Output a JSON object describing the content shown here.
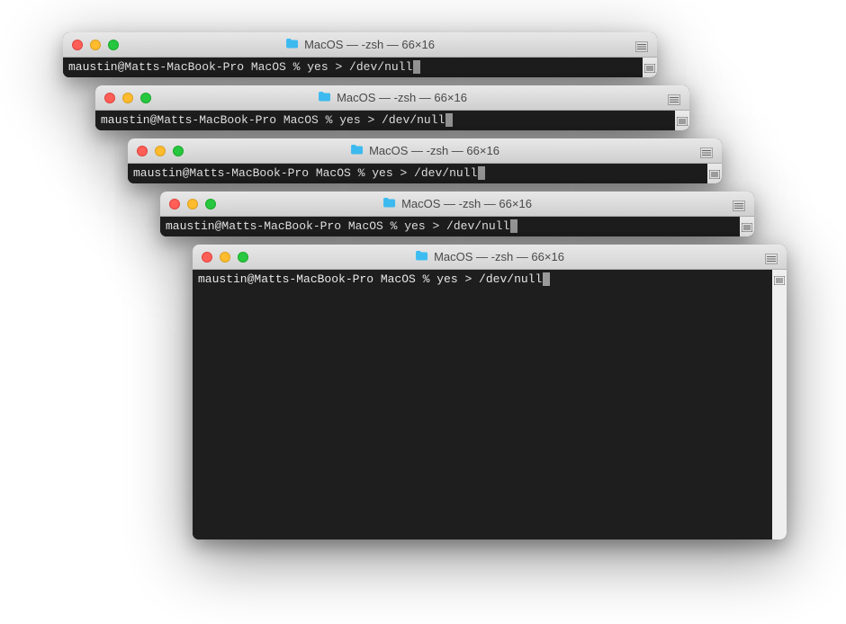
{
  "windows": [
    {
      "title": "MacOS — -zsh — 66×16",
      "prompt": "maustin@Matts-MacBook-Pro MacOS % ",
      "command": "yes > /dev/null"
    },
    {
      "title": "MacOS — -zsh — 66×16",
      "prompt": "maustin@Matts-MacBook-Pro MacOS % ",
      "command": "yes > /dev/null"
    },
    {
      "title": "MacOS — -zsh — 66×16",
      "prompt": "maustin@Matts-MacBook-Pro MacOS % ",
      "command": "yes > /dev/null"
    },
    {
      "title": "MacOS — -zsh — 66×16",
      "prompt": "maustin@Matts-MacBook-Pro MacOS % ",
      "command": "yes > /dev/null"
    },
    {
      "title": "MacOS — -zsh — 66×16",
      "prompt": "maustin@Matts-MacBook-Pro MacOS % ",
      "command": "yes > /dev/null"
    }
  ]
}
